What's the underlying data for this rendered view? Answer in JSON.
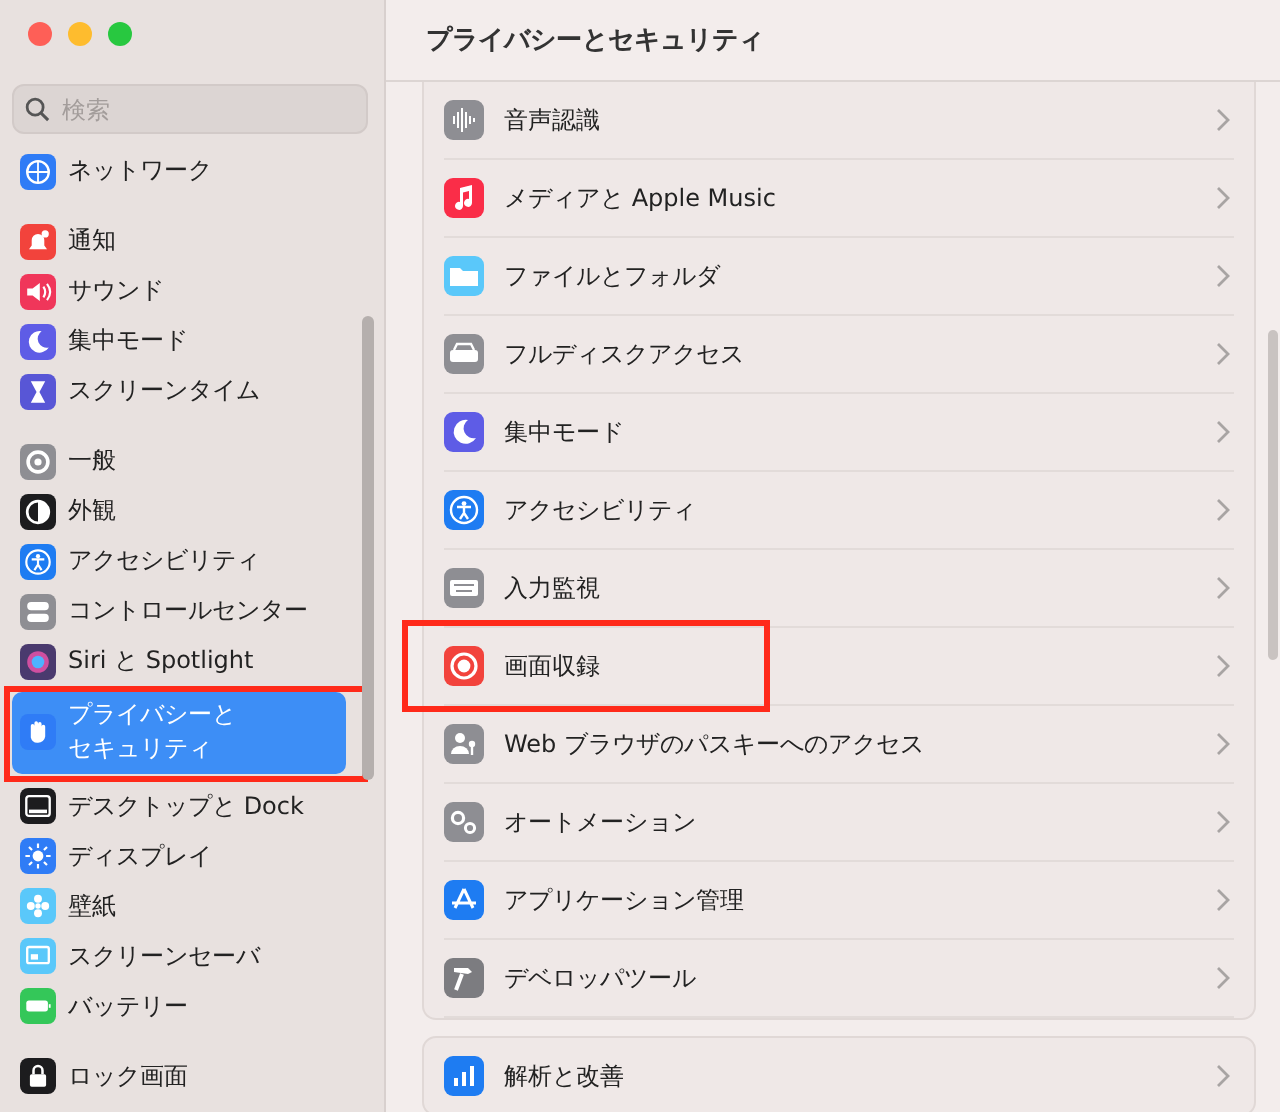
{
  "window": {
    "title": "プライバシーとセキュリティ"
  },
  "search": {
    "placeholder": "検索"
  },
  "sidebar": {
    "groups": [
      {
        "items": [
          {
            "label": "ネットワーク",
            "selected": false,
            "annotated": false
          }
        ]
      },
      {
        "items": [
          {
            "label": "通知",
            "selected": false,
            "annotated": false
          },
          {
            "label": "サウンド",
            "selected": false,
            "annotated": false
          },
          {
            "label": "集中モード",
            "selected": false,
            "annotated": false
          },
          {
            "label": "スクリーンタイム",
            "selected": false,
            "annotated": false
          }
        ]
      },
      {
        "items": [
          {
            "label": "一般",
            "selected": false,
            "annotated": false
          },
          {
            "label": "外観",
            "selected": false,
            "annotated": false
          },
          {
            "label": "アクセシビリティ",
            "selected": false,
            "annotated": false
          },
          {
            "label": "コントロールセンター",
            "selected": false,
            "annotated": false
          },
          {
            "label": "Siri と Spotlight",
            "selected": false,
            "annotated": false
          },
          {
            "label": "プライバシーとセキュリティ",
            "selected": true,
            "annotated": true
          },
          {
            "label": "デスクトップと Dock",
            "selected": false,
            "annotated": false
          },
          {
            "label": "ディスプレイ",
            "selected": false,
            "annotated": false
          },
          {
            "label": "壁紙",
            "selected": false,
            "annotated": false
          },
          {
            "label": "スクリーンセーバ",
            "selected": false,
            "annotated": false
          },
          {
            "label": "バッテリー",
            "selected": false,
            "annotated": false
          }
        ]
      },
      {
        "items": [
          {
            "label": "ロック画面",
            "selected": false,
            "annotated": false
          }
        ]
      }
    ]
  },
  "sections": [
    {
      "rows": [
        {
          "label": "音声認識",
          "annotated": false
        },
        {
          "label": "メディアと Apple Music",
          "annotated": false
        },
        {
          "label": "ファイルとフォルダ",
          "annotated": false
        },
        {
          "label": "フルディスクアクセス",
          "annotated": false
        },
        {
          "label": "集中モード",
          "annotated": false
        },
        {
          "label": "アクセシビリティ",
          "annotated": false
        },
        {
          "label": "入力監視",
          "annotated": false
        },
        {
          "label": "画面収録",
          "annotated": true
        },
        {
          "label": "Web ブラウザのパスキーへのアクセス",
          "annotated": false
        },
        {
          "label": "オートメーション",
          "annotated": false
        },
        {
          "label": "アプリケーション管理",
          "annotated": false
        },
        {
          "label": "デベロッパツール",
          "annotated": false
        }
      ]
    },
    {
      "rows": [
        {
          "label": "解析と改善",
          "annotated": false
        }
      ]
    }
  ]
}
